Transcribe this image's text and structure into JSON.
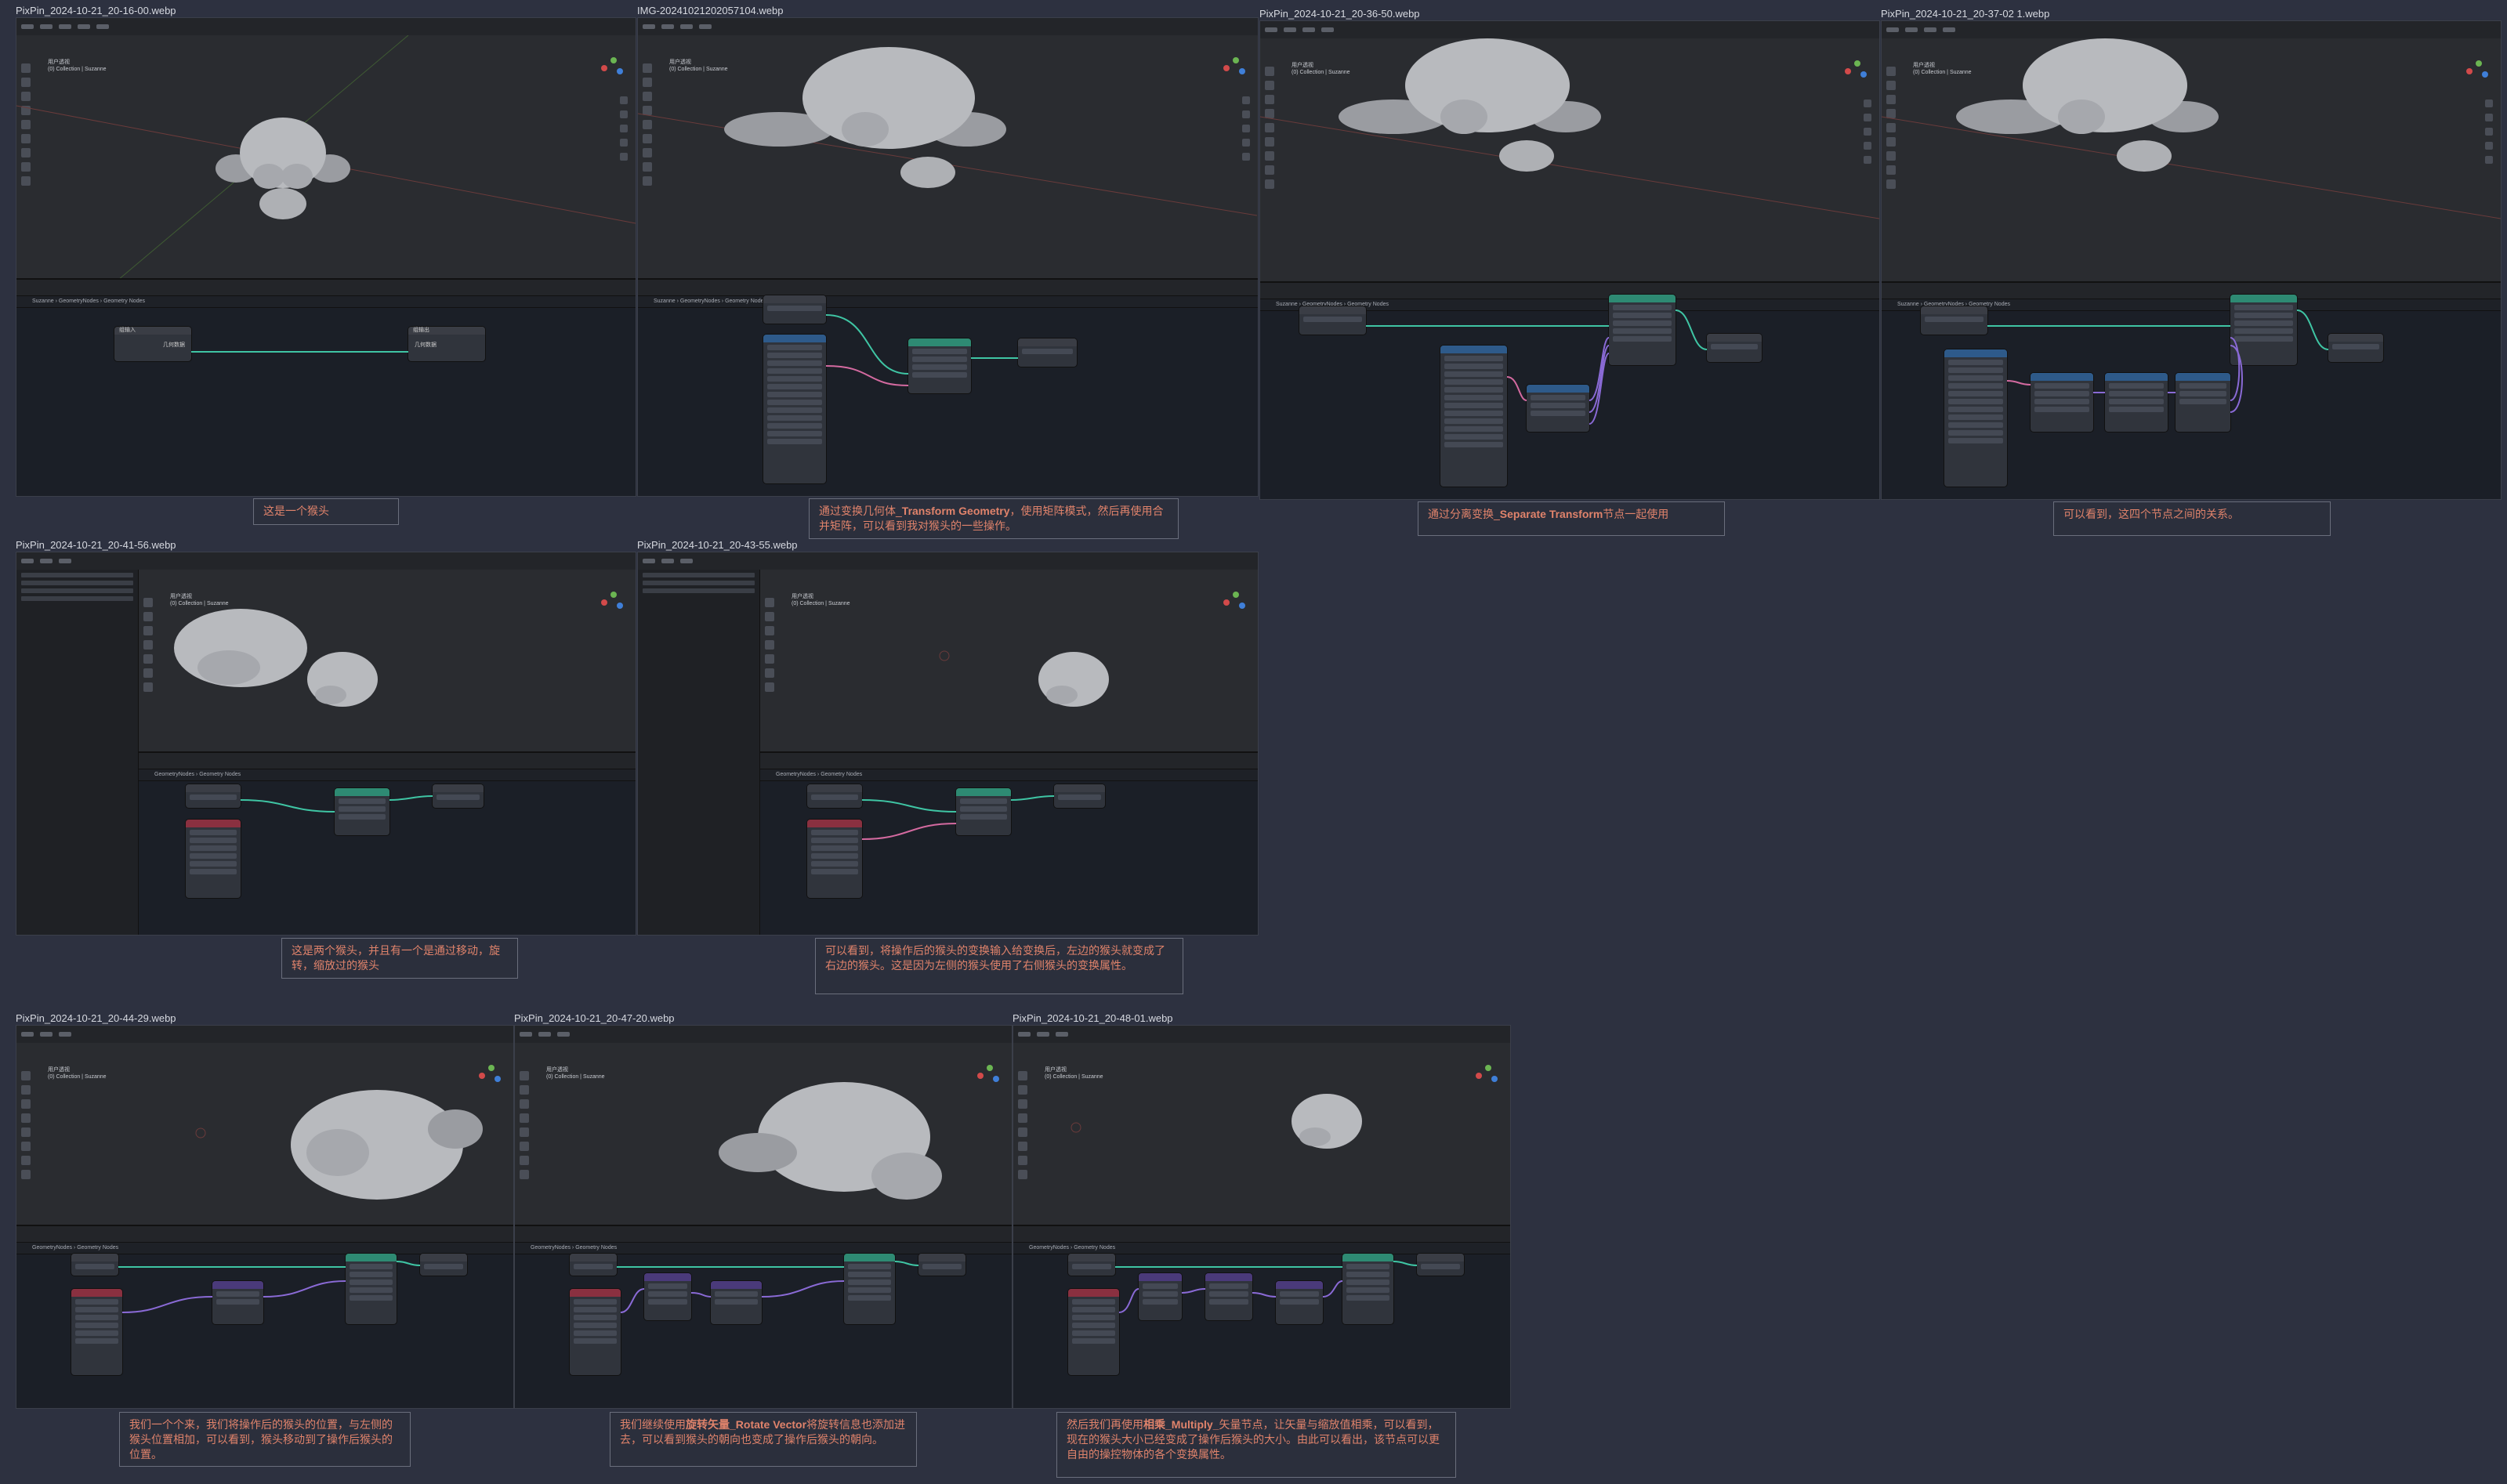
{
  "screenshots": [
    {
      "title": "PixPin_2024-10-21_20-16-00.webp"
    },
    {
      "title": "IMG-20241021202057104.webp"
    },
    {
      "title": "PixPin_2024-10-21_20-36-50.webp"
    },
    {
      "title": "PixPin_2024-10-21_20-37-02 1.webp"
    },
    {
      "title": "PixPin_2024-10-21_20-41-56.webp"
    },
    {
      "title": "PixPin_2024-10-21_20-43-55.webp"
    },
    {
      "title": "PixPin_2024-10-21_20-44-29.webp"
    },
    {
      "title": "PixPin_2024-10-21_20-47-20.webp"
    },
    {
      "title": "PixPin_2024-10-21_20-48-01.webp"
    }
  ],
  "captions": {
    "c1": "这是一个猴头",
    "c2_pre": "通过变换几何体_",
    "c2_bold": "Transform Geometry",
    "c2_post": "，使用矩阵模式，然后再使用合并矩阵，可以看到我对猴头的一些操作。",
    "c3_pre": "通过分离变换_",
    "c3_bold": "Separate Transform",
    "c3_post": "节点一起使用",
    "c4": "可以看到，这四个节点之间的关系。",
    "c5": "这是两个猴头，并且有一个是通过移动，旋转，缩放过的猴头",
    "c6": "可以看到，将操作后的猴头的变换输入给变换后，左边的猴头就变成了右边的猴头。这是因为左侧的猴头使用了右侧猴头的变换属性。",
    "c7": "我们一个个来，我们将操作后的猴头的位置，与左侧的猴头位置相加，可以看到，猴头移动到了操作后猴头的位置。",
    "c8_pre": "我们继续使用",
    "c8_bold": "旋转矢量_Rotate Vector",
    "c8_post": "将旋转信息也添加进去，可以看到猴头的朝向也变成了操作后猴头的朝向。",
    "c9_pre": "然后我们再使用",
    "c9_bold": "相乘_Multiply_",
    "c9_mid": "矢量",
    "c9_post": "节点，让矢量与缩放值相乘，可以看到，现在的猴头大小已经变成了操作后猴头的大小。由此可以看出，该节点可以更自由的操控物体的各个变换属性。"
  },
  "viewport_info": {
    "line1": "用户透视",
    "line2": "(0) Collection | Suzanne"
  },
  "breadcrumb": {
    "object": "Suzanne",
    "modifier": "GeometryNodes",
    "tree": "Geometry Nodes"
  },
  "node_labels": {
    "group_input": "组输入",
    "group_output": "组输出",
    "geometry": "几何数据"
  },
  "colors": {
    "background": "#2d3140",
    "caption_text": "#e0836b",
    "link_green": "#3fc5a4",
    "link_pink": "#d46aa0",
    "link_purple": "#8a6ad6"
  }
}
